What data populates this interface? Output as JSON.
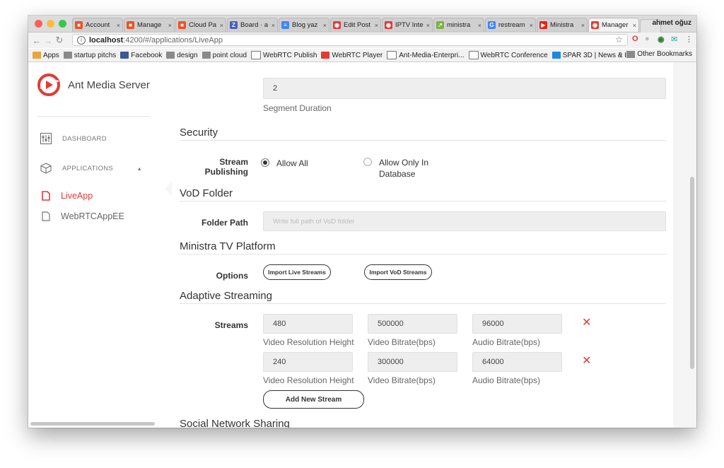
{
  "browser": {
    "profile_name": "ahmet oğuz",
    "tabs": [
      {
        "label": "Account",
        "icon": "microsoft-icon",
        "color": "#f25022"
      },
      {
        "label": "Manage",
        "icon": "microsoft-icon",
        "color": "#f25022"
      },
      {
        "label": "Cloud Pa",
        "icon": "microsoft-icon",
        "color": "#f25022"
      },
      {
        "label": "Board · a",
        "icon": "zenhub-icon",
        "color": "#4a5fc1"
      },
      {
        "label": "Blog yaz",
        "icon": "docs-icon",
        "color": "#4285f4"
      },
      {
        "label": "Edit Post",
        "icon": "antmedia-icon",
        "color": "#e53935"
      },
      {
        "label": "IPTV Inte",
        "icon": "antmedia-icon",
        "color": "#e53935"
      },
      {
        "label": "ministra",
        "icon": "trend-icon",
        "color": "#7cb342"
      },
      {
        "label": "restream",
        "icon": "google-icon",
        "color": "#4285f4"
      },
      {
        "label": "Ministra",
        "icon": "youtube-icon",
        "color": "#e62117"
      },
      {
        "label": "Manager",
        "icon": "antmedia-icon",
        "color": "#e53935",
        "active": true
      }
    ],
    "url_host": "localhost",
    "url_path": ":4200/#/applications/LiveApp",
    "bookmarks": [
      {
        "label": "Apps",
        "icon": "apps-grid-icon"
      },
      {
        "label": "startup pitchs",
        "icon": "folder-icon"
      },
      {
        "label": "Facebook",
        "icon": "facebook-icon"
      },
      {
        "label": "design",
        "icon": "folder-icon"
      },
      {
        "label": "point cloud",
        "icon": "folder-icon"
      },
      {
        "label": "WebRTC Publish",
        "icon": "page-icon"
      },
      {
        "label": "WebRTC Player",
        "icon": "antmedia-icon"
      },
      {
        "label": "Ant-Media-Enterpri...",
        "icon": "page-icon"
      },
      {
        "label": "WebRTC Conference",
        "icon": "page-icon"
      },
      {
        "label": "SPAR 3D | News & I...",
        "icon": "spar3d-icon"
      }
    ],
    "bookmarks_overflow": "»",
    "other_bookmarks": "Other Bookmarks"
  },
  "sidebar": {
    "brand": "Ant Media Server",
    "nav": [
      {
        "label": "DASHBOARD",
        "icon": "sliders-icon"
      },
      {
        "label": "APPLICATIONS",
        "icon": "cube-icon",
        "chevron": "▴"
      }
    ],
    "apps": [
      {
        "label": "LiveApp",
        "active": true
      },
      {
        "label": "WebRTCAppEE",
        "active": false
      }
    ]
  },
  "main": {
    "segment_duration": {
      "value": "2",
      "label": "Segment Duration"
    },
    "security": {
      "title": "Security",
      "row_label": "Stream Publishing",
      "options": [
        {
          "label": "Allow All",
          "selected": true
        },
        {
          "label": "Allow Only In Database",
          "selected": false
        }
      ]
    },
    "vod": {
      "title": "VoD Folder",
      "row_label": "Folder Path",
      "placeholder": "Write full path of VoD folder",
      "value": ""
    },
    "ministra": {
      "title": "Ministra TV Platform",
      "row_label": "Options",
      "buttons": [
        "Import Live Streams",
        "Import VoD Streams"
      ]
    },
    "adaptive": {
      "title": "Adaptive Streaming",
      "row_label": "Streams",
      "streams": [
        {
          "height": "480",
          "video_bitrate": "500000",
          "audio_bitrate": "96000"
        },
        {
          "height": "240",
          "video_bitrate": "300000",
          "audio_bitrate": "64000"
        }
      ],
      "field_labels": [
        "Video Resolution Height",
        "Video Bitrate(bps)",
        "Audio Bitrate(bps)"
      ],
      "remove_symbol": "✕",
      "add_button": "Add New Stream"
    },
    "social": {
      "title": "Social Network Sharing"
    }
  }
}
